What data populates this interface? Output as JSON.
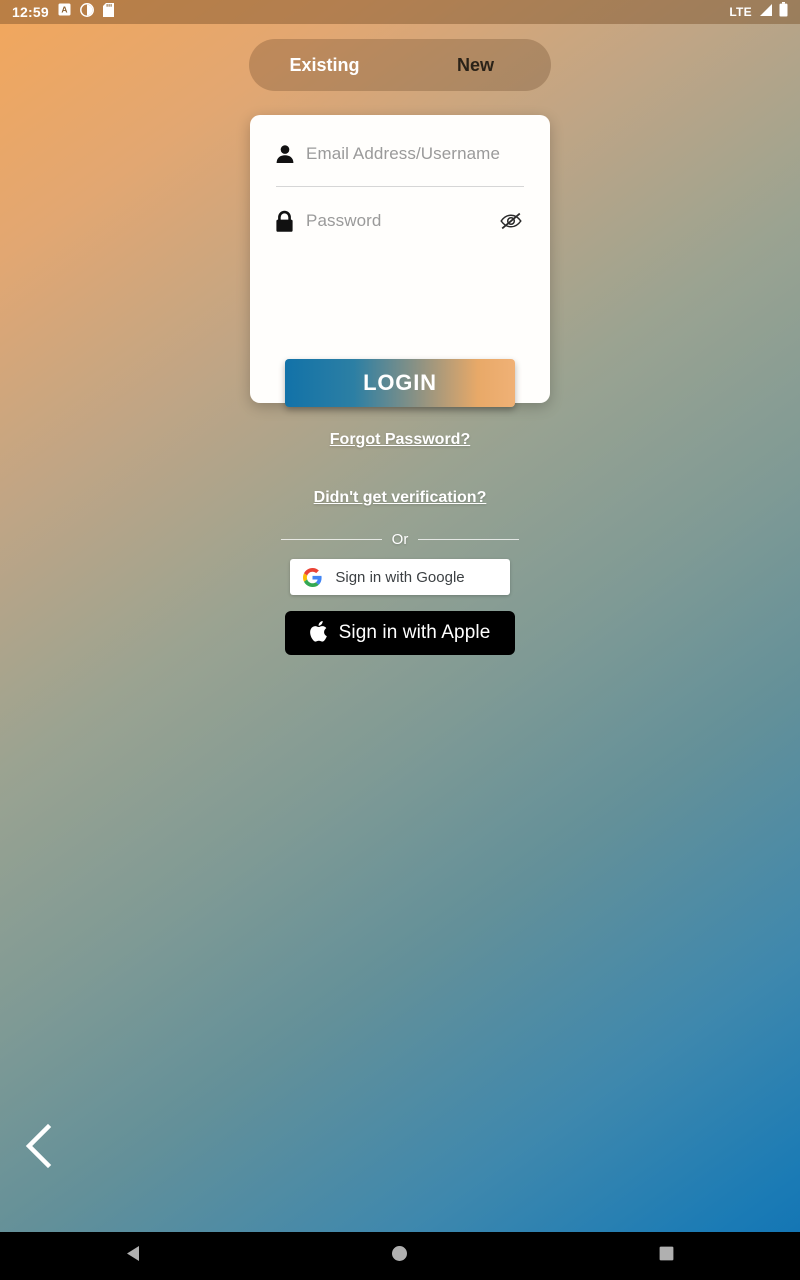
{
  "status_bar": {
    "clock": "12:59",
    "left_icons": [
      "a-badge-icon",
      "brightness-icon",
      "sd-card-icon"
    ],
    "network_label": "LTE",
    "right_icons": [
      "signal-icon",
      "battery-icon"
    ]
  },
  "tabs": {
    "existing_label": "Existing",
    "new_label": "New",
    "selected": "Existing"
  },
  "form": {
    "email": {
      "placeholder": "Email Address/Username",
      "value": "",
      "icon": "person-icon"
    },
    "password": {
      "placeholder": "Password",
      "value": "",
      "icon": "lock-icon",
      "toggle_icon": "eye-off-icon"
    }
  },
  "actions": {
    "login_label": "LOGIN",
    "forgot_password_label": "Forgot Password?",
    "verification_label": "Didn't get verification?"
  },
  "divider": {
    "or_label": "Or"
  },
  "social": {
    "google_label": "Sign in with Google",
    "google_icon": "google-g-icon",
    "apple_label": "Sign in with Apple",
    "apple_icon": "apple-logo-icon"
  },
  "navigation": {
    "back_chevron_icon": "chevron-left-icon",
    "system_back_icon": "triangle-back-icon",
    "system_home_icon": "circle-home-icon",
    "system_recents_icon": "square-recents-icon"
  },
  "colors": {
    "background_start": "#f2a75c",
    "background_mid": "#5d8a92",
    "background_end": "#0f72b4",
    "login_gradient_start": "#1272a8",
    "login_gradient_end": "#f0b176",
    "card_background": "#fffefc",
    "apple_button": "#000000",
    "placeholder_text": "#9a9a9a"
  }
}
